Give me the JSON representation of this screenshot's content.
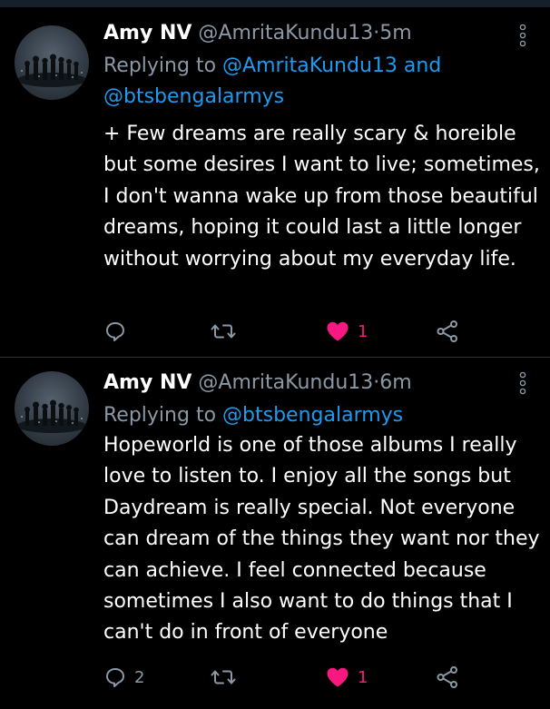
{
  "tweets": [
    {
      "name": "Amy NV",
      "handle": "@AmritaKundu13",
      "separator": "·",
      "time": "5m",
      "replying_prefix": "Replying to",
      "mentions": [
        "@AmritaKundu13",
        "@btsbengalarmys"
      ],
      "mention_joiner": "and",
      "text": "+ Few dreams are really scary & horeible but some desires I want to live; sometimes, I don't wanna wake up from those beautiful dreams, hoping it could last a little longer without worrying about my everyday life.",
      "reply_count": "",
      "retweet_count": "",
      "like_count": "1",
      "liked": true
    },
    {
      "name": "Amy NV",
      "handle": "@AmritaKundu13",
      "separator": "·",
      "time": "6m",
      "replying_prefix": "Replying to",
      "mentions": [
        "@btsbengalarmys"
      ],
      "text": "Hopeworld is one of those albums I really love to listen to. I enjoy all the songs but Daydream is really special. Not everyone can dream of the things they want nor they can achieve. I feel connected because sometimes I also want to do things that I can't do in front of everyone",
      "reply_count": "2",
      "retweet_count": "",
      "like_count": "1",
      "liked": true
    }
  ],
  "colors": {
    "background": "#000000",
    "text": "#ffffff",
    "secondary": "#8b98a5",
    "link": "#1d9bf0",
    "like": "#f91880",
    "divider": "#2f3336"
  },
  "icons": {
    "reply": "reply-bubble-icon",
    "retweet": "retweet-icon",
    "like": "heart-filled-icon",
    "share": "share-icon",
    "more": "more-vertical-icon"
  }
}
